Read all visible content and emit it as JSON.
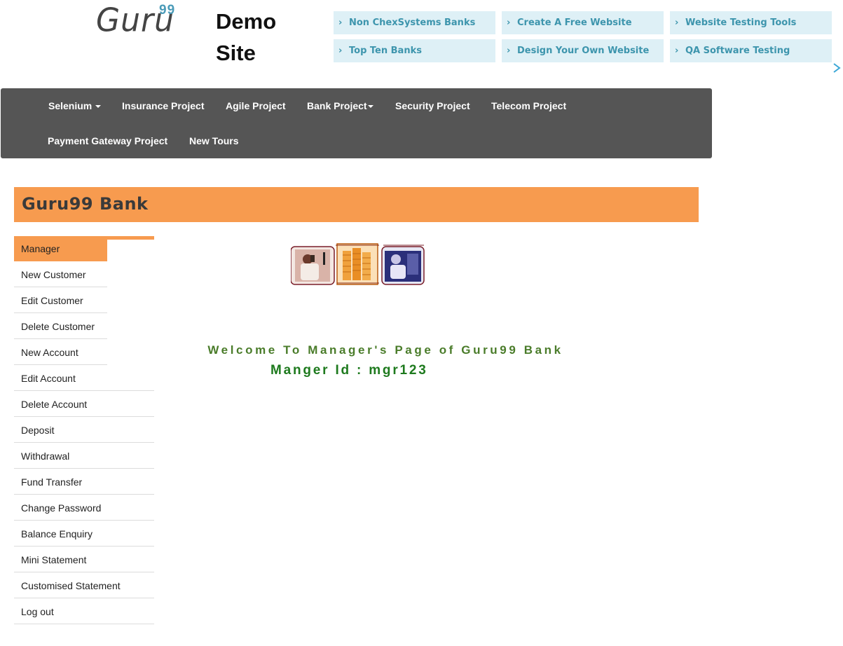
{
  "header": {
    "logo_text": "Guru",
    "logo_sup": "99",
    "site_title_line1": "Demo",
    "site_title_line2": "Site"
  },
  "ads": [
    {
      "label": "Non ChexSystems Banks"
    },
    {
      "label": "Create A Free Website"
    },
    {
      "label": "Website Testing Tools"
    },
    {
      "label": "Top Ten Banks"
    },
    {
      "label": "Design Your Own Website"
    },
    {
      "label": "QA Software Testing"
    }
  ],
  "nav": {
    "items": [
      {
        "label": "Selenium"
      },
      {
        "label": "Insurance Project"
      },
      {
        "label": "Agile Project"
      },
      {
        "label": "Bank Project"
      },
      {
        "label": "Security Project"
      },
      {
        "label": "Telecom Project"
      },
      {
        "label": "Payment Gateway Project"
      },
      {
        "label": "New Tours"
      }
    ]
  },
  "bank": {
    "title": "Guru99 Bank"
  },
  "menu": {
    "items": [
      {
        "label": "Manager",
        "active": true
      },
      {
        "label": "New Customer"
      },
      {
        "label": "Edit Customer"
      },
      {
        "label": "Delete Customer"
      },
      {
        "label": "New Account"
      },
      {
        "label": "Edit Account"
      },
      {
        "label": "Delete Account"
      },
      {
        "label": "Deposit"
      },
      {
        "label": "Withdrawal"
      },
      {
        "label": "Fund Transfer"
      },
      {
        "label": "Change Password"
      },
      {
        "label": "Balance Enquiry"
      },
      {
        "label": "Mini Statement"
      },
      {
        "label": "Customised Statement"
      },
      {
        "label": "Log out"
      }
    ]
  },
  "content": {
    "welcome": "Welcome To Manager's Page of Guru99 Bank",
    "manager_id": "Manger Id : mgr123"
  },
  "colors": {
    "accent_orange": "#f79b4f",
    "nav_bg": "#555555",
    "ad_bg": "#def0f6",
    "ad_text": "#3d95ad",
    "welcome_green": "#4a7c2a"
  }
}
